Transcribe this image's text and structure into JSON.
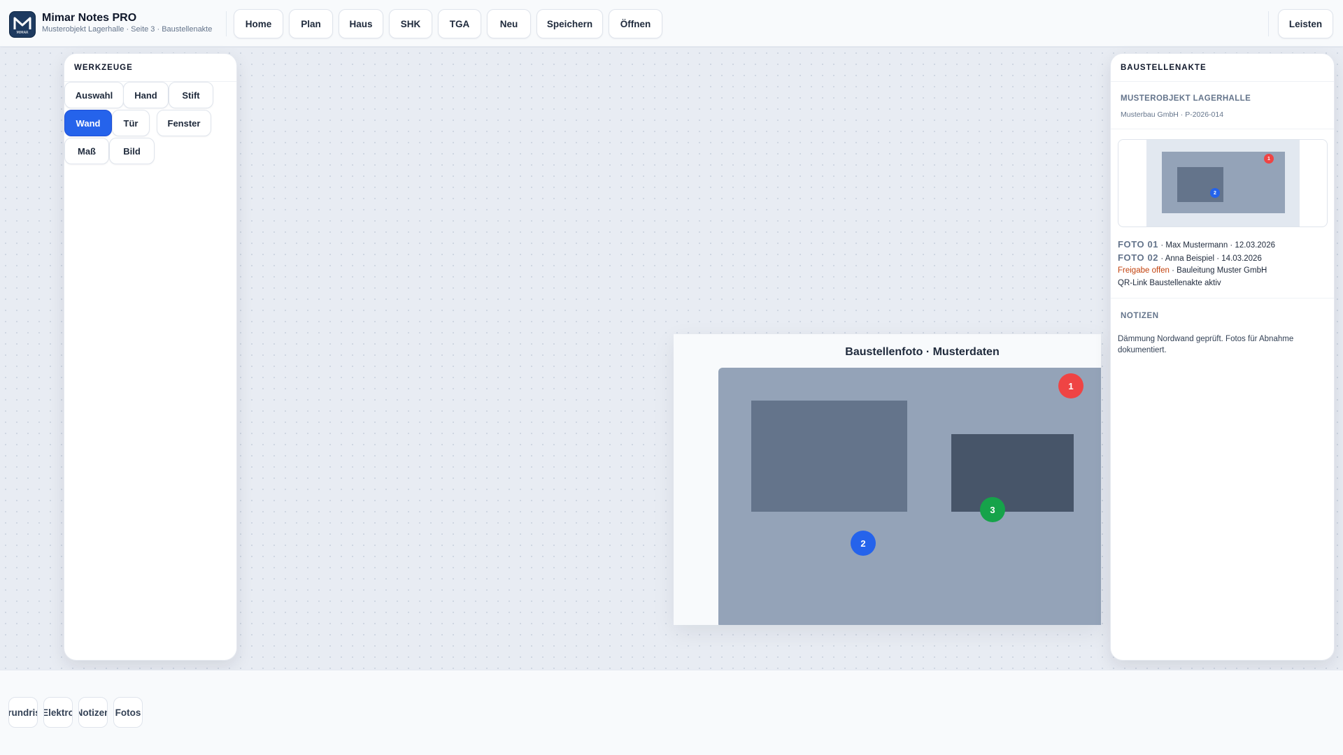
{
  "app": {
    "title": "Mimar Notes PRO",
    "subtitle": "Musterobjekt Lagerhalle · Seite 3 · Baustellenakte",
    "logo_text": "MIMAR"
  },
  "nav": {
    "home": "Home",
    "plan": "Plan",
    "haus": "Haus",
    "shk": "SHK",
    "tga": "TGA",
    "neu": "Neu",
    "speichern": "Speichern",
    "oeffnen": "Öffnen",
    "leisten": "Leisten"
  },
  "tools": {
    "heading": "WERKZEUGE",
    "items": [
      "Auswahl",
      "Hand",
      "Stift",
      "Wand",
      "Tür",
      "Fenster",
      "Maß",
      "Bild"
    ],
    "active": "Wand"
  },
  "photo": {
    "title": "Baustellenfoto · Musterdaten",
    "markers": [
      "1",
      "2",
      "3"
    ]
  },
  "panel": {
    "heading": "BAUSTELLENAKTE",
    "project_name": "MUSTEROBJEKT LAGERHALLE",
    "project_sub": "Musterbau GmbH · P-2026-014",
    "thumb_markers": [
      "1",
      "2"
    ],
    "foto1_label": "FOTO 01",
    "foto1_text": " · Max Mustermann · 12.03.2026",
    "foto2_label": "FOTO 02",
    "foto2_text": " · Anna Beispiel · 14.03.2026",
    "freigabe_status": "Freigabe offen",
    "freigabe_text": " · Bauleitung Muster GmbH",
    "qr_text": "QR-Link Baustellenakte aktiv",
    "notes_heading": "NOTIZEN",
    "notes_text": "Dämmung Nordwand geprüft. Fotos für Abnahme dokumentiert."
  },
  "bottom_tabs": [
    "Grundriss",
    "Elektro",
    "Notizen",
    "Fotos"
  ],
  "colors": {
    "accent": "#2563eb",
    "marker_red": "#ef4444",
    "marker_blue": "#2563eb",
    "marker_green": "#16a34a",
    "status_orange": "#c2410c"
  }
}
